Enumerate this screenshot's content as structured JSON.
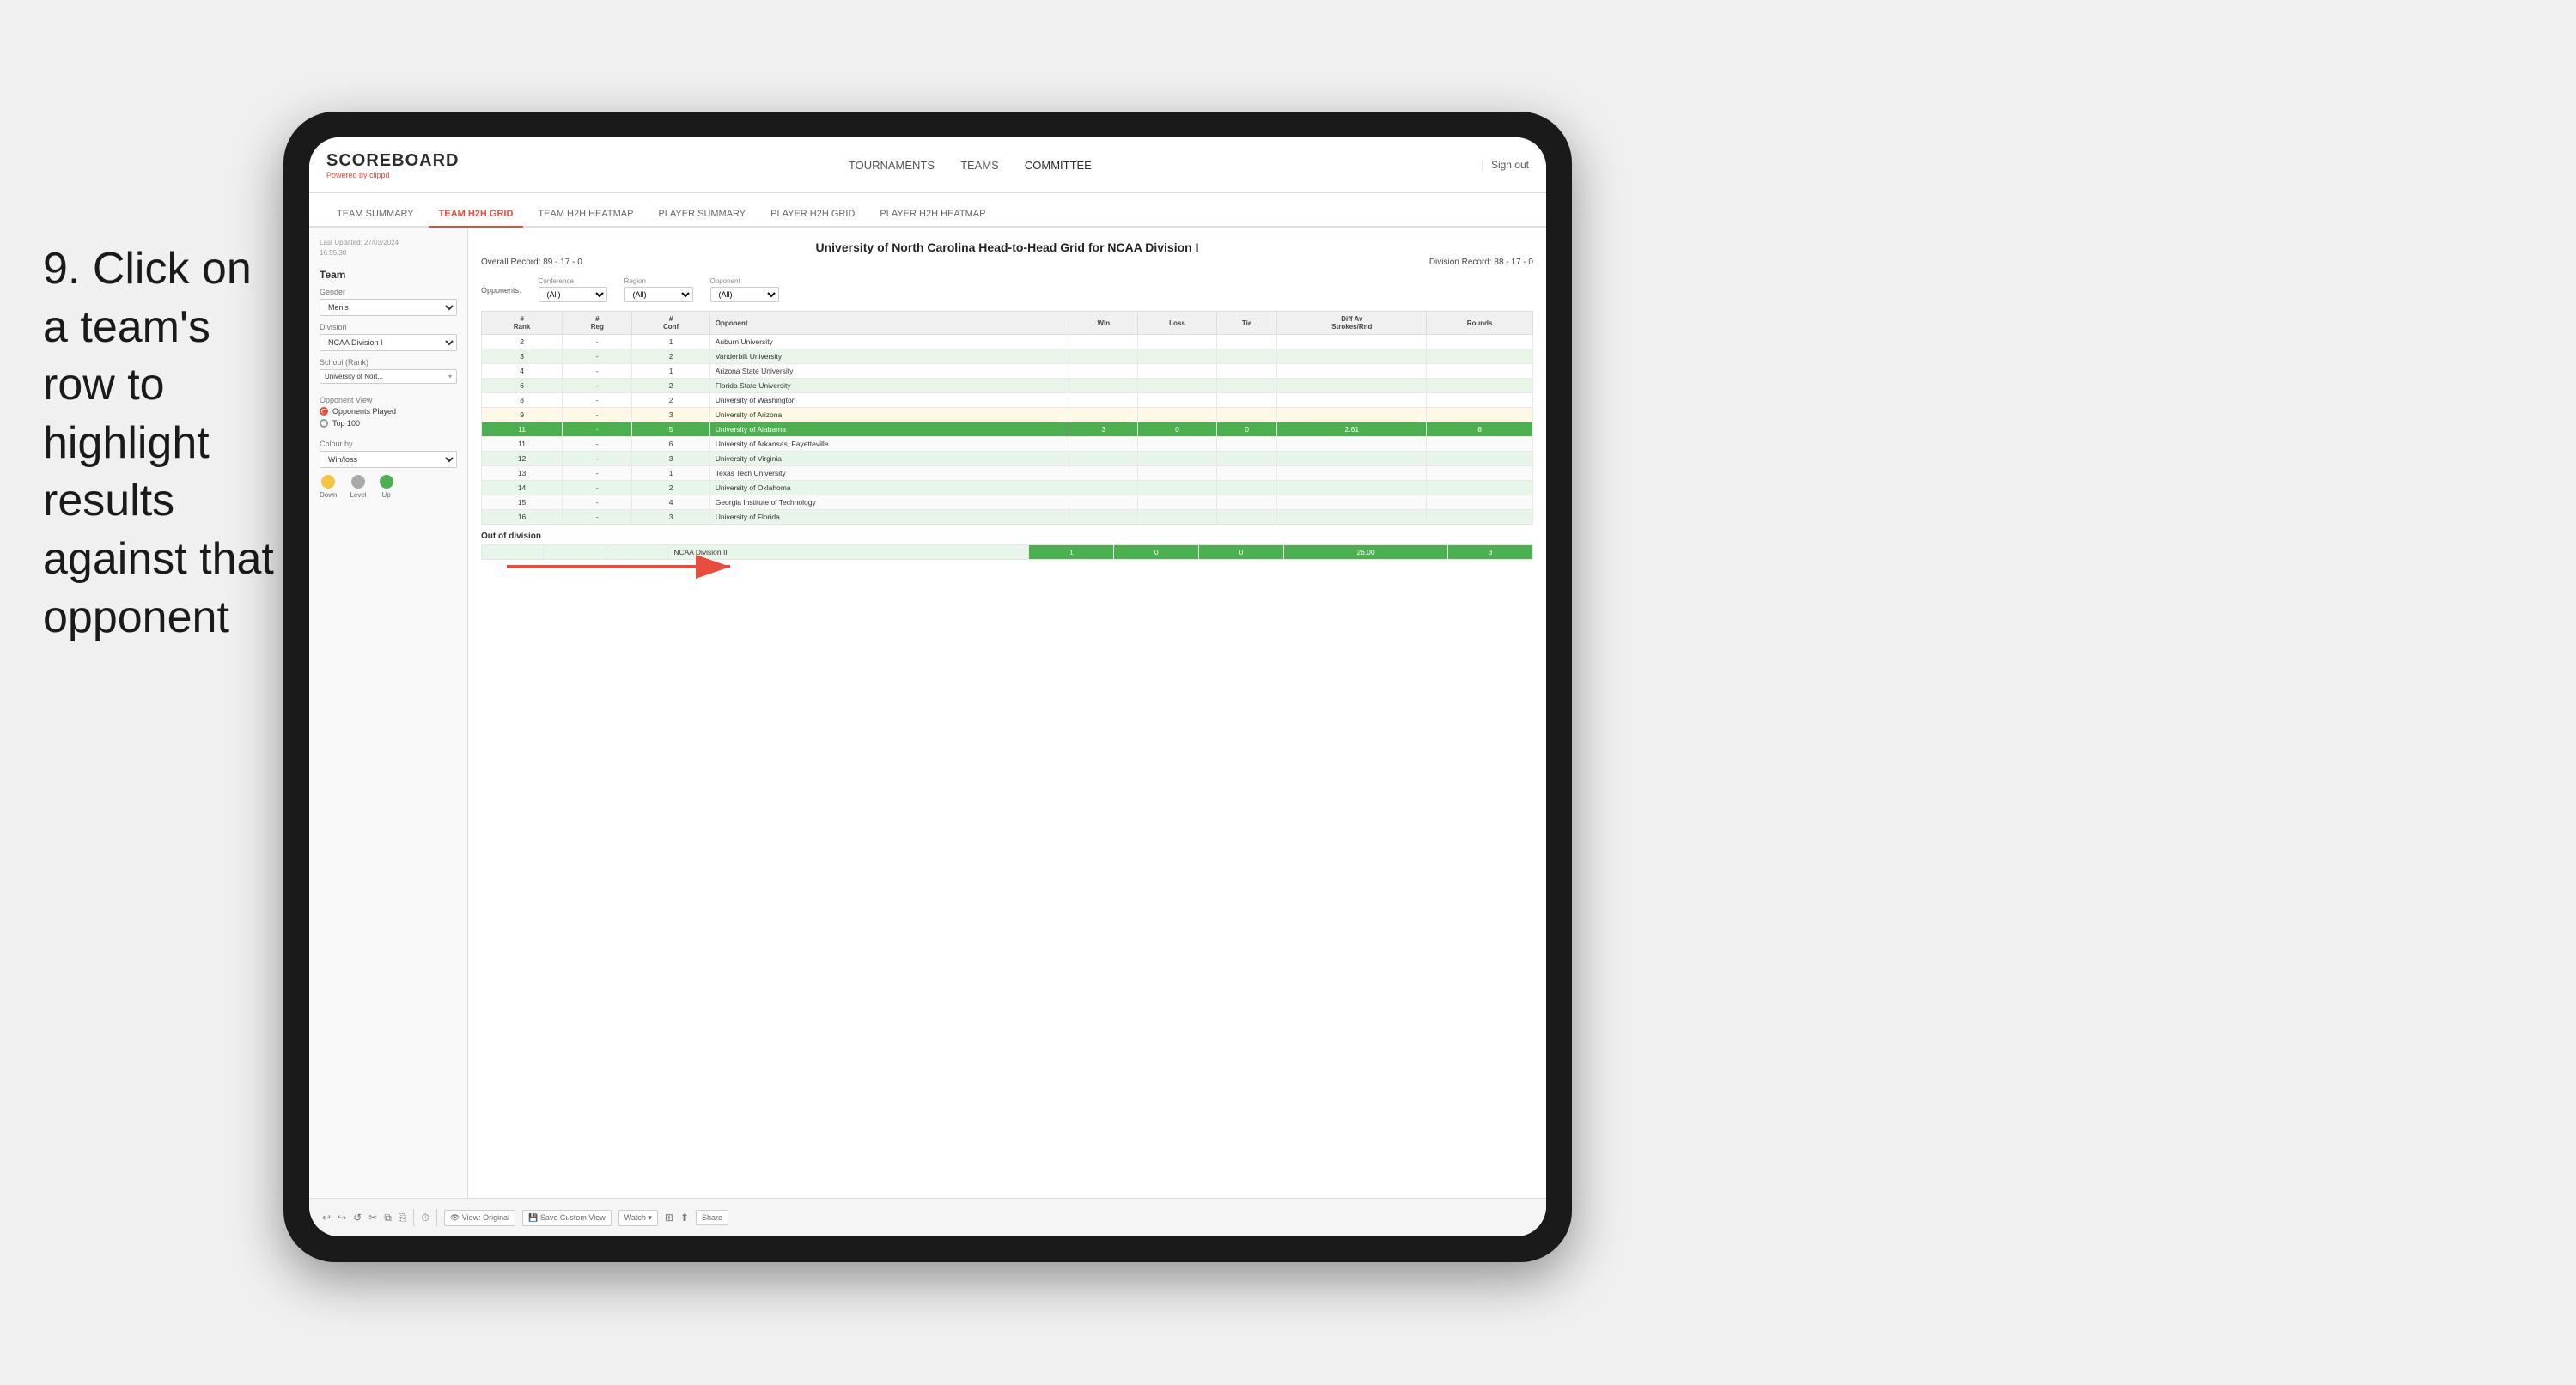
{
  "page": {
    "background": "#f0f0f0"
  },
  "instruction": {
    "number": "9.",
    "text": "Click on a team's row to highlight results against that opponent"
  },
  "nav": {
    "logo": "SCOREBOARD",
    "logo_sub": "Powered by",
    "logo_brand": "clippd",
    "links": [
      "TOURNAMENTS",
      "TEAMS",
      "COMMITTEE"
    ],
    "sign_out": "Sign out"
  },
  "sub_tabs": [
    {
      "label": "TEAM SUMMARY",
      "active": false
    },
    {
      "label": "TEAM H2H GRID",
      "active": true
    },
    {
      "label": "TEAM H2H HEATMAP",
      "active": false
    },
    {
      "label": "PLAYER SUMMARY",
      "active": false
    },
    {
      "label": "PLAYER H2H GRID",
      "active": false
    },
    {
      "label": "PLAYER H2H HEATMAP",
      "active": false
    }
  ],
  "left_panel": {
    "last_updated": "Last Updated: 27/03/2024",
    "time": "16:55:38",
    "team_label": "Team",
    "gender_label": "Gender",
    "gender_value": "Men's",
    "division_label": "Division",
    "division_value": "NCAA Division I",
    "school_label": "School (Rank)",
    "school_value": "University of Nort...",
    "opponent_view_label": "Opponent View",
    "opponents_played": "Opponents Played",
    "top_100": "Top 100",
    "colour_by_label": "Colour by",
    "colour_by_value": "Win/loss",
    "legend": [
      {
        "label": "Down",
        "color": "#f5c542"
      },
      {
        "label": "Level",
        "color": "#aaaaaa"
      },
      {
        "label": "Up",
        "color": "#4caf50"
      }
    ]
  },
  "grid": {
    "title": "University of North Carolina Head-to-Head Grid for NCAA Division I",
    "overall_record": "Overall Record: 89 - 17 - 0",
    "division_record": "Division Record: 88 - 17 - 0",
    "filters": {
      "opponents_label": "Opponents:",
      "opponents_value": "(All)",
      "conference_label": "Conference",
      "conference_value": "(All)",
      "region_label": "Region",
      "region_value": "(All)",
      "opponent_label": "Opponent",
      "opponent_value": "(All)"
    },
    "col_headers": [
      "#\nRank",
      "#\nReg",
      "#\nConf",
      "Opponent",
      "Win",
      "Loss",
      "Tie",
      "Diff Av\nStrokes/Rnd",
      "Rounds"
    ],
    "rows": [
      {
        "rank": "2",
        "reg": "-",
        "conf": "1",
        "opponent": "Auburn University",
        "win": "",
        "loss": "",
        "tie": "",
        "diff": "",
        "rounds": "",
        "style": "normal"
      },
      {
        "rank": "3",
        "reg": "-",
        "conf": "2",
        "opponent": "Vanderbilt University",
        "win": "",
        "loss": "",
        "tie": "",
        "diff": "",
        "rounds": "",
        "style": "light-green"
      },
      {
        "rank": "4",
        "reg": "-",
        "conf": "1",
        "opponent": "Arizona State University",
        "win": "",
        "loss": "",
        "tie": "",
        "diff": "",
        "rounds": "",
        "style": "normal"
      },
      {
        "rank": "6",
        "reg": "-",
        "conf": "2",
        "opponent": "Florida State University",
        "win": "",
        "loss": "",
        "tie": "",
        "diff": "",
        "rounds": "",
        "style": "light-green"
      },
      {
        "rank": "8",
        "reg": "-",
        "conf": "2",
        "opponent": "University of Washington",
        "win": "",
        "loss": "",
        "tie": "",
        "diff": "",
        "rounds": "",
        "style": "normal"
      },
      {
        "rank": "9",
        "reg": "-",
        "conf": "3",
        "opponent": "University of Arizona",
        "win": "",
        "loss": "",
        "tie": "",
        "diff": "",
        "rounds": "",
        "style": "light-yellow"
      },
      {
        "rank": "11",
        "reg": "-",
        "conf": "5",
        "opponent": "University of Alabama",
        "win": "3",
        "loss": "0",
        "tie": "0",
        "diff": "2.61",
        "rounds": "8",
        "style": "highlighted"
      },
      {
        "rank": "11",
        "reg": "-",
        "conf": "6",
        "opponent": "University of Arkansas, Fayetteville",
        "win": "",
        "loss": "",
        "tie": "",
        "diff": "",
        "rounds": "",
        "style": "normal"
      },
      {
        "rank": "12",
        "reg": "-",
        "conf": "3",
        "opponent": "University of Virginia",
        "win": "",
        "loss": "",
        "tie": "",
        "diff": "",
        "rounds": "",
        "style": "light-green"
      },
      {
        "rank": "13",
        "reg": "-",
        "conf": "1",
        "opponent": "Texas Tech University",
        "win": "",
        "loss": "",
        "tie": "",
        "diff": "",
        "rounds": "",
        "style": "normal"
      },
      {
        "rank": "14",
        "reg": "-",
        "conf": "2",
        "opponent": "University of Oklahoma",
        "win": "",
        "loss": "",
        "tie": "",
        "diff": "",
        "rounds": "",
        "style": "light-green"
      },
      {
        "rank": "15",
        "reg": "-",
        "conf": "4",
        "opponent": "Georgia Institute of Technology",
        "win": "",
        "loss": "",
        "tie": "",
        "diff": "",
        "rounds": "",
        "style": "normal"
      },
      {
        "rank": "16",
        "reg": "-",
        "conf": "3",
        "opponent": "University of Florida",
        "win": "",
        "loss": "",
        "tie": "",
        "diff": "",
        "rounds": "",
        "style": "light-green"
      }
    ],
    "out_of_division_label": "Out of division",
    "out_of_division_row": {
      "label": "NCAA Division II",
      "win": "1",
      "loss": "0",
      "tie": "0",
      "diff": "26.00",
      "rounds": "3"
    }
  },
  "toolbar": {
    "view_label": "View: Original",
    "save_label": "Save Custom View",
    "watch_label": "Watch ▾",
    "share_label": "Share"
  }
}
